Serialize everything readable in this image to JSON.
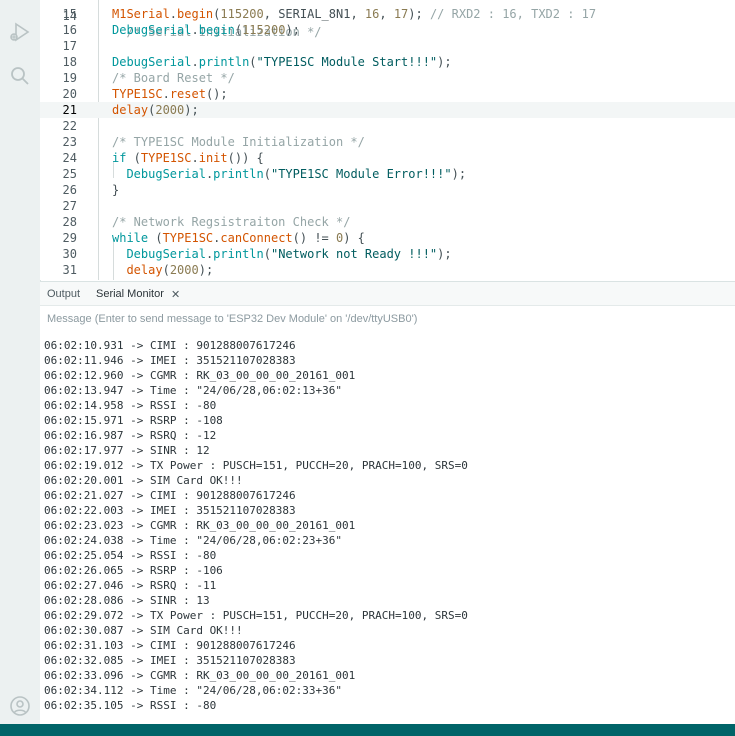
{
  "icons": {
    "run_debug": "run-debug-icon",
    "search": "search-icon",
    "profile": "profile-icon",
    "close": "close-icon"
  },
  "editor": {
    "partial_top_line": {
      "number": "14",
      "text": "  /* Serial Initialization */"
    },
    "current_line": "21",
    "lines": [
      {
        "number": "15",
        "tokens": [
          {
            "t": "M1Serial",
            "c": "f"
          },
          {
            "t": ".",
            "c": "o"
          },
          {
            "t": "begin",
            "c": "f"
          },
          {
            "t": "(",
            "c": "o"
          },
          {
            "t": "115200",
            "c": "n"
          },
          {
            "t": ", SERIAL_8N1, ",
            "c": "o"
          },
          {
            "t": "16",
            "c": "n"
          },
          {
            "t": ", ",
            "c": "o"
          },
          {
            "t": "17",
            "c": "n"
          },
          {
            "t": "); ",
            "c": "o"
          },
          {
            "t": "// RXD2 : 16, TXD2 : 17",
            "c": "c"
          }
        ]
      },
      {
        "number": "16",
        "tokens": [
          {
            "t": "DebugSerial",
            "c": "k"
          },
          {
            "t": ".",
            "c": "o"
          },
          {
            "t": "begin",
            "c": "k"
          },
          {
            "t": "(",
            "c": "o"
          },
          {
            "t": "115200",
            "c": "n"
          },
          {
            "t": ");",
            "c": "o"
          }
        ]
      },
      {
        "number": "17",
        "tokens": []
      },
      {
        "number": "18",
        "tokens": [
          {
            "t": "DebugSerial",
            "c": "k"
          },
          {
            "t": ".",
            "c": "o"
          },
          {
            "t": "println",
            "c": "k"
          },
          {
            "t": "(",
            "c": "o"
          },
          {
            "t": "\"TYPE1SC Module Start!!!\"",
            "c": "s"
          },
          {
            "t": ");",
            "c": "o"
          }
        ]
      },
      {
        "number": "19",
        "tokens": [
          {
            "t": "/* Board Reset */",
            "c": "c"
          }
        ]
      },
      {
        "number": "20",
        "tokens": [
          {
            "t": "TYPE1SC",
            "c": "f"
          },
          {
            "t": ".",
            "c": "o"
          },
          {
            "t": "reset",
            "c": "f"
          },
          {
            "t": "();",
            "c": "o"
          }
        ]
      },
      {
        "number": "21",
        "tokens": [
          {
            "t": "delay",
            "c": "f"
          },
          {
            "t": "(",
            "c": "o"
          },
          {
            "t": "2000",
            "c": "n"
          },
          {
            "t": ");",
            "c": "o"
          }
        ]
      },
      {
        "number": "22",
        "tokens": []
      },
      {
        "number": "23",
        "tokens": [
          {
            "t": "/* TYPE1SC Module Initialization */",
            "c": "c"
          }
        ]
      },
      {
        "number": "24",
        "tokens": [
          {
            "t": "if",
            "c": "k"
          },
          {
            "t": " (",
            "c": "o"
          },
          {
            "t": "TYPE1SC",
            "c": "f"
          },
          {
            "t": ".",
            "c": "o"
          },
          {
            "t": "init",
            "c": "f"
          },
          {
            "t": "()) {",
            "c": "o"
          }
        ]
      },
      {
        "number": "25",
        "tokens": [
          {
            "t": "  ",
            "c": "o"
          },
          {
            "t": "DebugSerial",
            "c": "k"
          },
          {
            "t": ".",
            "c": "o"
          },
          {
            "t": "println",
            "c": "k"
          },
          {
            "t": "(",
            "c": "o"
          },
          {
            "t": "\"TYPE1SC Module Error!!!\"",
            "c": "s"
          },
          {
            "t": ");",
            "c": "o"
          }
        ]
      },
      {
        "number": "26",
        "tokens": [
          {
            "t": "}",
            "c": "o"
          }
        ]
      },
      {
        "number": "27",
        "tokens": []
      },
      {
        "number": "28",
        "tokens": [
          {
            "t": "/* Network Regsistraiton Check */",
            "c": "c"
          }
        ]
      },
      {
        "number": "29",
        "tokens": [
          {
            "t": "while",
            "c": "k"
          },
          {
            "t": " (",
            "c": "o"
          },
          {
            "t": "TYPE1SC",
            "c": "f"
          },
          {
            "t": ".",
            "c": "o"
          },
          {
            "t": "canConnect",
            "c": "f"
          },
          {
            "t": "() != ",
            "c": "o"
          },
          {
            "t": "0",
            "c": "n"
          },
          {
            "t": ") {",
            "c": "o"
          }
        ]
      },
      {
        "number": "30",
        "tokens": [
          {
            "t": "  ",
            "c": "o"
          },
          {
            "t": "DebugSerial",
            "c": "k"
          },
          {
            "t": ".",
            "c": "o"
          },
          {
            "t": "println",
            "c": "k"
          },
          {
            "t": "(",
            "c": "o"
          },
          {
            "t": "\"Network not Ready !!!\"",
            "c": "s"
          },
          {
            "t": ");",
            "c": "o"
          }
        ]
      },
      {
        "number": "31",
        "tokens": [
          {
            "t": "  ",
            "c": "o"
          },
          {
            "t": "delay",
            "c": "f"
          },
          {
            "t": "(",
            "c": "o"
          },
          {
            "t": "2000",
            "c": "n"
          },
          {
            "t": ");",
            "c": "o"
          }
        ]
      }
    ]
  },
  "panel": {
    "tabs": [
      {
        "label": "Output"
      },
      {
        "label": "Serial Monitor"
      }
    ],
    "message_placeholder": "Message (Enter to send message to 'ESP32 Dev Module' on '/dev/ttyUSB0')",
    "message_value": ""
  },
  "serial_lines": [
    "06:02:10.931 -> CIMI : 901288007617246",
    "06:02:11.946 -> IMEI : 351521107028383",
    "06:02:12.960 -> CGMR : RK_03_00_00_00_20161_001",
    "06:02:13.947 -> Time : \"24/06/28,06:02:13+36\"",
    "06:02:14.958 -> RSSI : -80",
    "06:02:15.971 -> RSRP : -108",
    "06:02:16.987 -> RSRQ : -12",
    "06:02:17.977 -> SINR : 12",
    "06:02:19.012 -> TX Power : PUSCH=151, PUCCH=20, PRACH=100, SRS=0",
    "06:02:20.001 -> SIM Card OK!!!",
    "06:02:21.027 -> CIMI : 901288007617246",
    "06:02:22.003 -> IMEI : 351521107028383",
    "06:02:23.023 -> CGMR : RK_03_00_00_00_20161_001",
    "06:02:24.038 -> Time : \"24/06/28,06:02:23+36\"",
    "06:02:25.054 -> RSSI : -80",
    "06:02:26.065 -> RSRP : -106",
    "06:02:27.046 -> RSRQ : -11",
    "06:02:28.086 -> SINR : 13",
    "06:02:29.072 -> TX Power : PUSCH=151, PUCCH=20, PRACH=100, SRS=0",
    "06:02:30.087 -> SIM Card OK!!!",
    "06:02:31.103 -> CIMI : 901288007617246",
    "06:02:32.085 -> IMEI : 351521107028383",
    "06:02:33.096 -> CGMR : RK_03_00_00_00_20161_001",
    "06:02:34.112 -> Time : \"24/06/28,06:02:33+36\"",
    "06:02:35.105 -> RSSI : -80"
  ]
}
